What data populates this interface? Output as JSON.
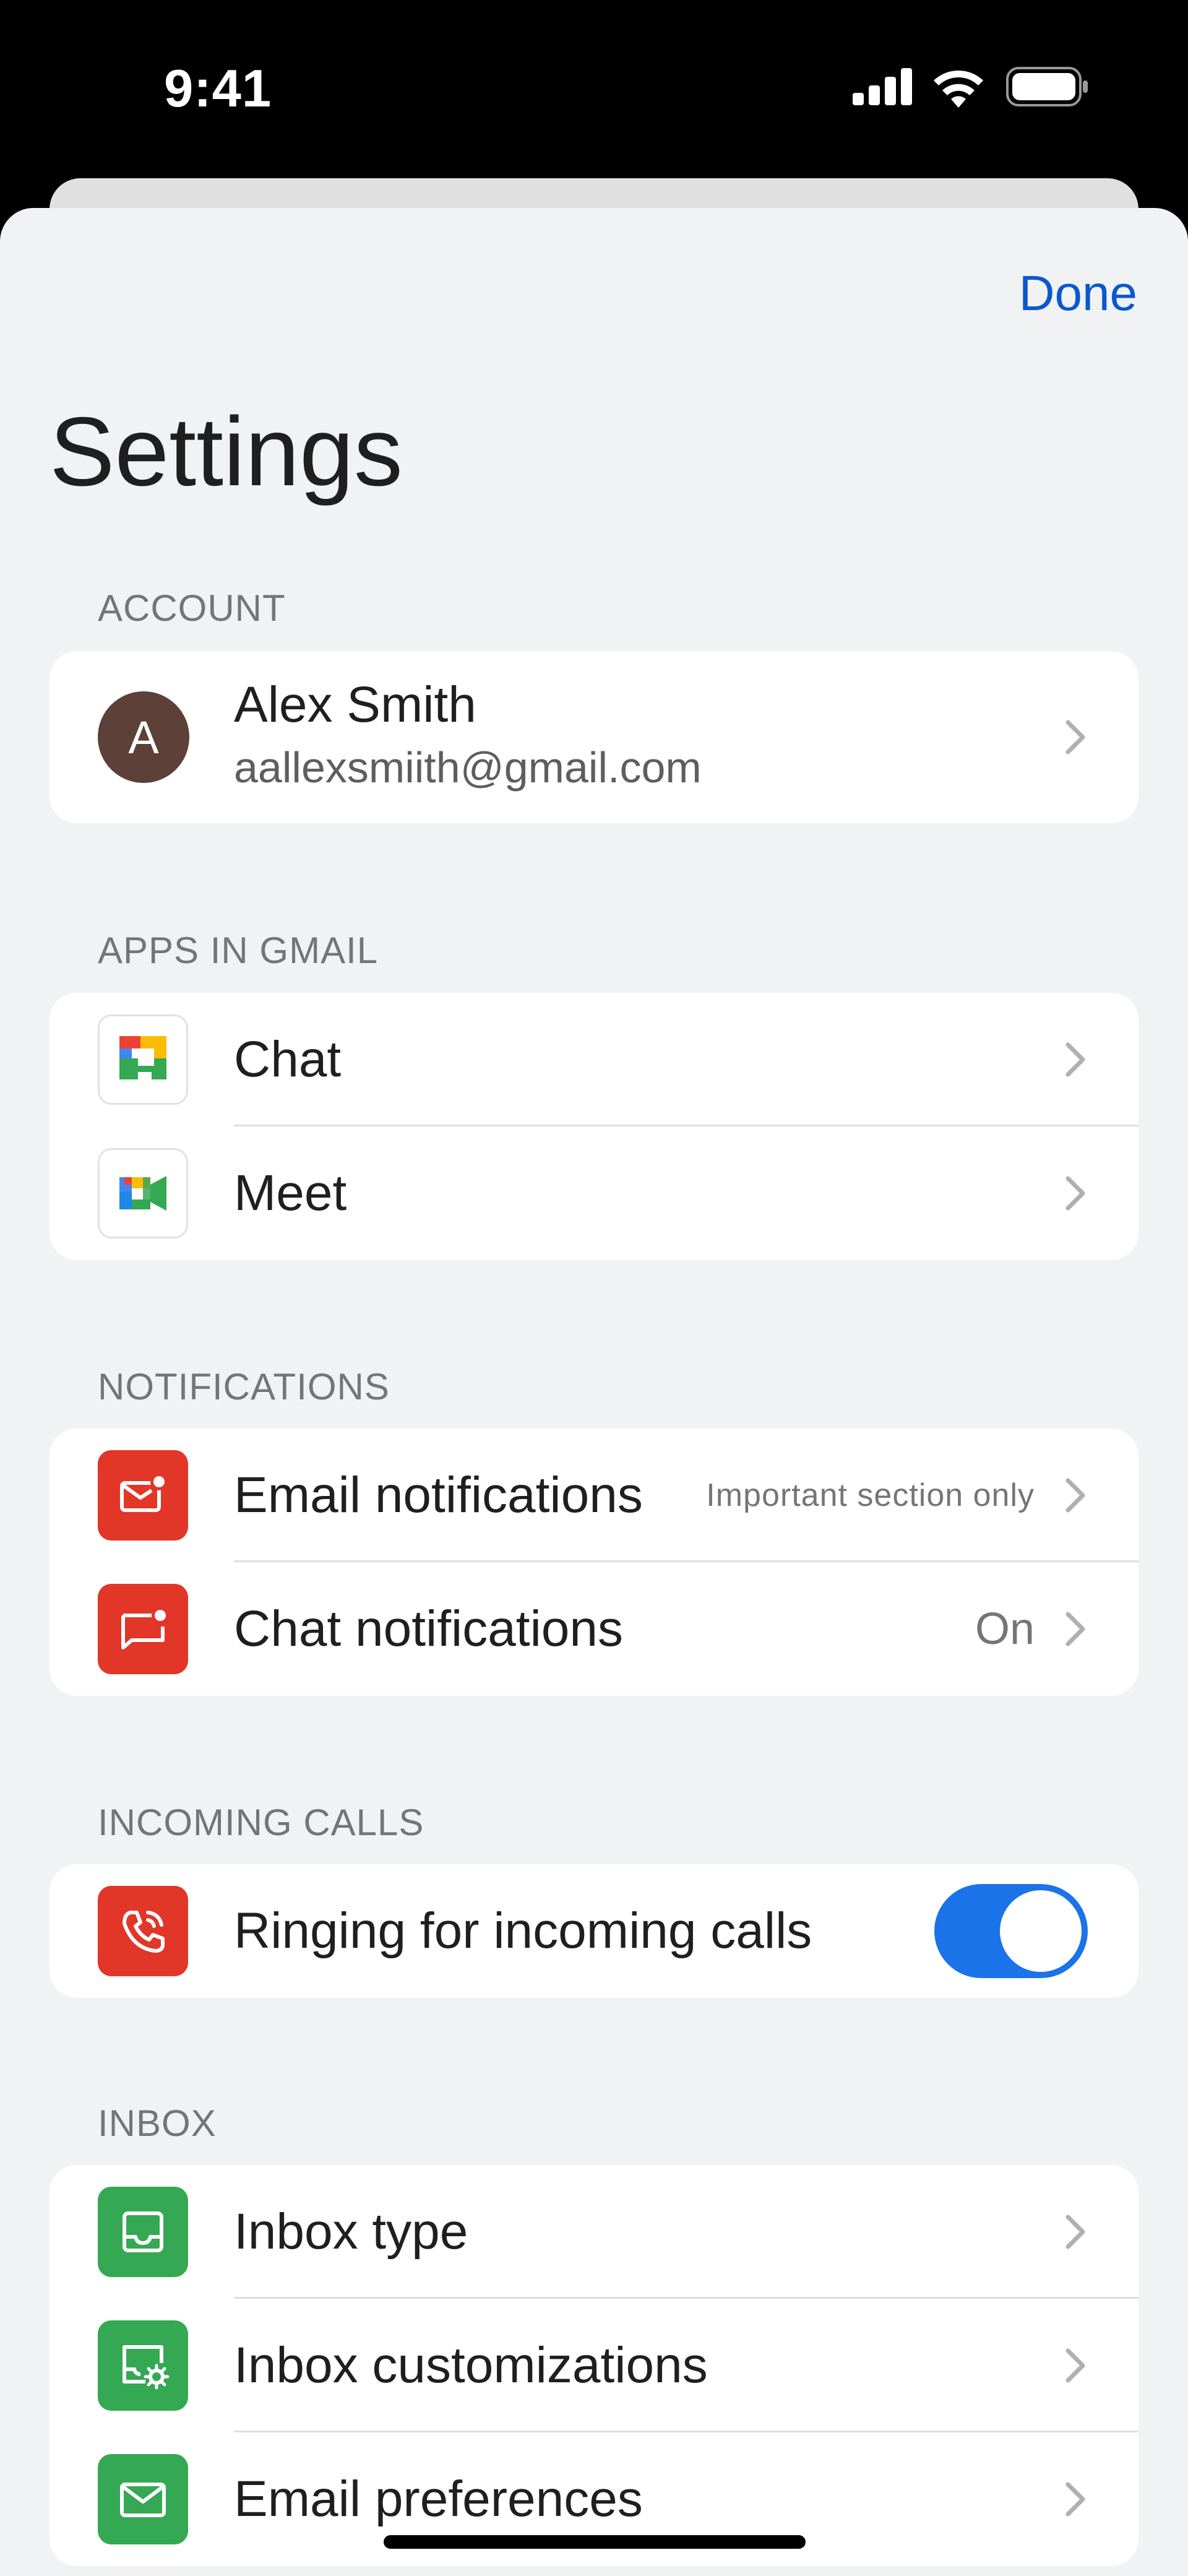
{
  "status_bar": {
    "time": "9:41",
    "icons": [
      "signal-icon",
      "wifi-icon",
      "battery-icon"
    ]
  },
  "header": {
    "done_label": "Done",
    "title": "Settings"
  },
  "colors": {
    "accent": "#0b57d0",
    "toggle_on": "#1a73e8",
    "red_tile": "#e13628",
    "green_tile": "#34a853",
    "avatar": "#5d4037",
    "background": "#f1f2f4"
  },
  "account": {
    "section_label": "ACCOUNT",
    "avatar_initial": "A",
    "name": "Alex Smith",
    "email": "aallexsmiith@gmail.com"
  },
  "apps": {
    "section_label": "APPS IN GMAIL",
    "items": [
      {
        "label": "Chat",
        "icon": "google-chat-icon"
      },
      {
        "label": "Meet",
        "icon": "google-meet-icon"
      }
    ]
  },
  "notifications": {
    "section_label": "NOTIFICATIONS",
    "items": [
      {
        "label": "Email notifications",
        "value": "Important section only",
        "icon": "email-notification-icon"
      },
      {
        "label": "Chat notifications",
        "value": "On",
        "icon": "chat-notification-icon"
      }
    ]
  },
  "incoming_calls": {
    "section_label": "INCOMING CALLS",
    "items": [
      {
        "label": "Ringing for incoming calls",
        "toggle_on": true,
        "icon": "phone-ringing-icon"
      }
    ]
  },
  "inbox": {
    "section_label": "INBOX",
    "items": [
      {
        "label": "Inbox type",
        "icon": "inbox-tray-icon"
      },
      {
        "label": "Inbox customizations",
        "icon": "inbox-settings-icon"
      },
      {
        "label": "Email preferences",
        "icon": "envelope-icon"
      }
    ]
  }
}
